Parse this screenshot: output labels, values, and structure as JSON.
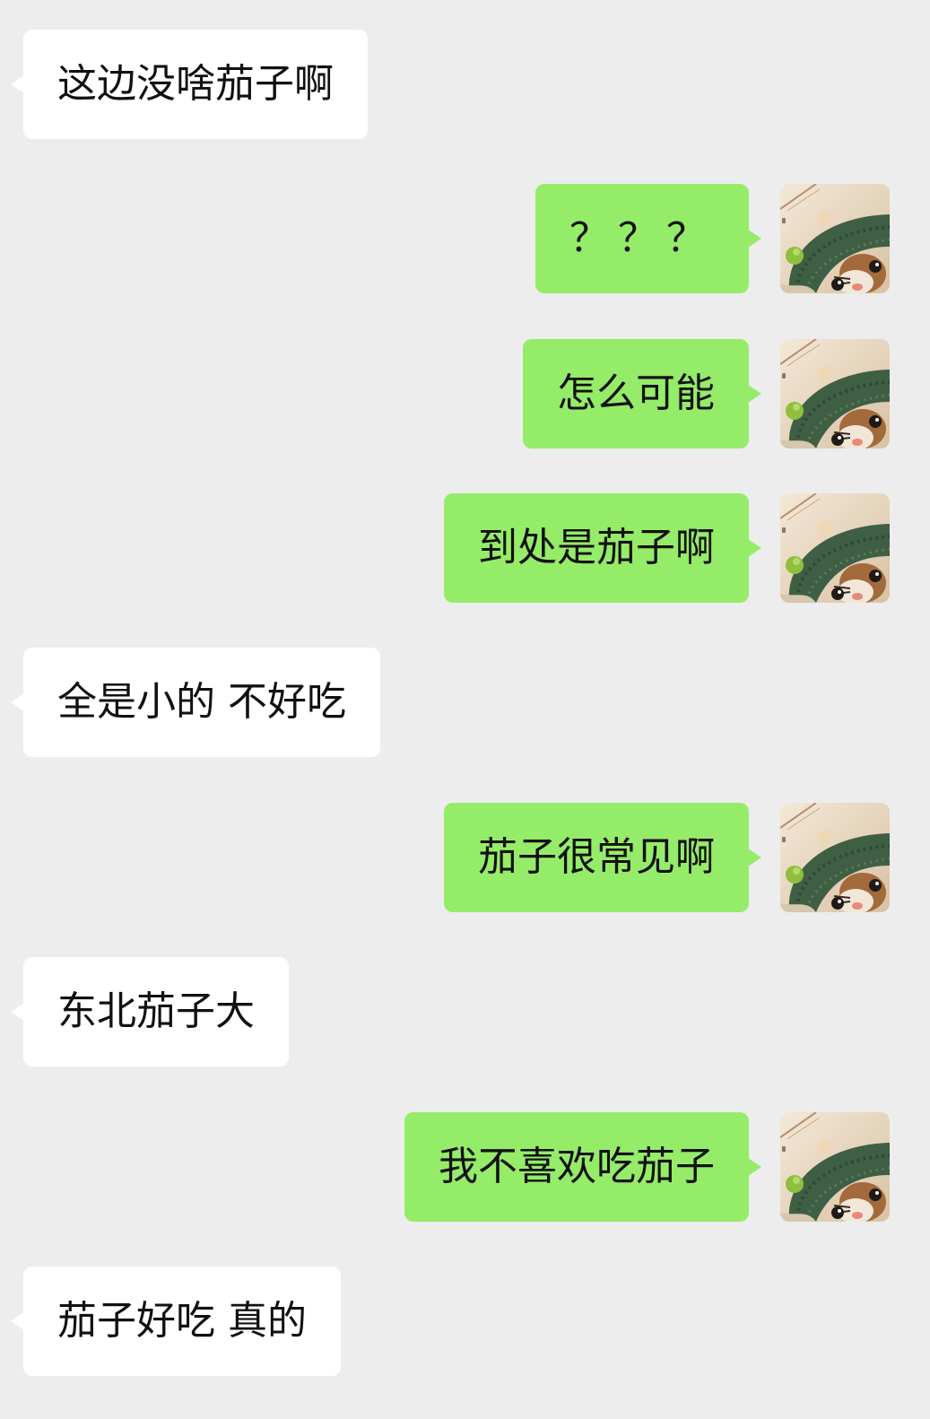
{
  "messages": [
    {
      "side": "in",
      "text": "这边没啥茄子啊"
    },
    {
      "side": "out",
      "text": "？？？"
    },
    {
      "side": "out",
      "text": "怎么可能"
    },
    {
      "side": "out",
      "text": "到处是茄子啊"
    },
    {
      "side": "in",
      "text": "全是小的 不好吃"
    },
    {
      "side": "out",
      "text": "茄子很常见啊"
    },
    {
      "side": "in",
      "text": "东北茄子大"
    },
    {
      "side": "out",
      "text": "我不喜欢吃茄子"
    },
    {
      "side": "in",
      "text": "茄子好吃 真的"
    }
  ],
  "colors": {
    "background": "#ededed",
    "incoming_bubble": "#ffffff",
    "outgoing_bubble": "#95ec69"
  },
  "avatar": {
    "icon": "cat-in-green-hat-avatar"
  }
}
